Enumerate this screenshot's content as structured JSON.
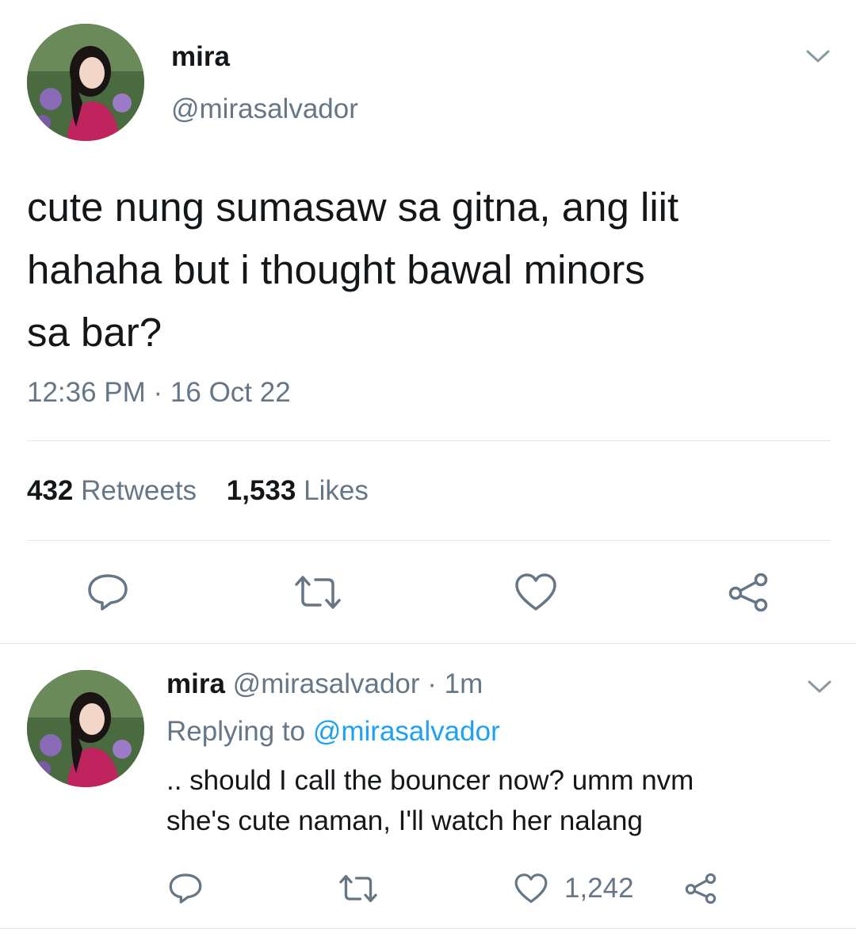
{
  "tweet": {
    "display_name": "mira",
    "handle": "@mirasalvador",
    "text_line1": "cute nung sumasaw sa gitna, ang liit",
    "text_line2": "hahaha but i thought bawal minors",
    "text_line3": "sa bar?",
    "timestamp": "12:36 PM · 16 Oct 22",
    "retweet_count": "432",
    "retweet_label": "Retweets",
    "like_count": "1,533",
    "like_label": "Likes"
  },
  "reply": {
    "display_name": "mira",
    "handle": "@mirasalvador",
    "time": "· 1m",
    "replying_prefix": "Replying to",
    "replying_to": "@mirasalvador",
    "text_line1": ".. should I call the bouncer now? umm nvm",
    "text_line2": "she's cute naman, I'll watch her nalang",
    "like_count": "1,242"
  },
  "icons": {
    "menu": "chevron-down-icon",
    "reply": "reply-icon",
    "retweet": "retweet-icon",
    "like": "heart-icon",
    "share": "share-icon"
  },
  "colors": {
    "text": "#14171a",
    "secondary": "#657786",
    "link": "#1da1f2",
    "divider": "#e1e8ed"
  }
}
